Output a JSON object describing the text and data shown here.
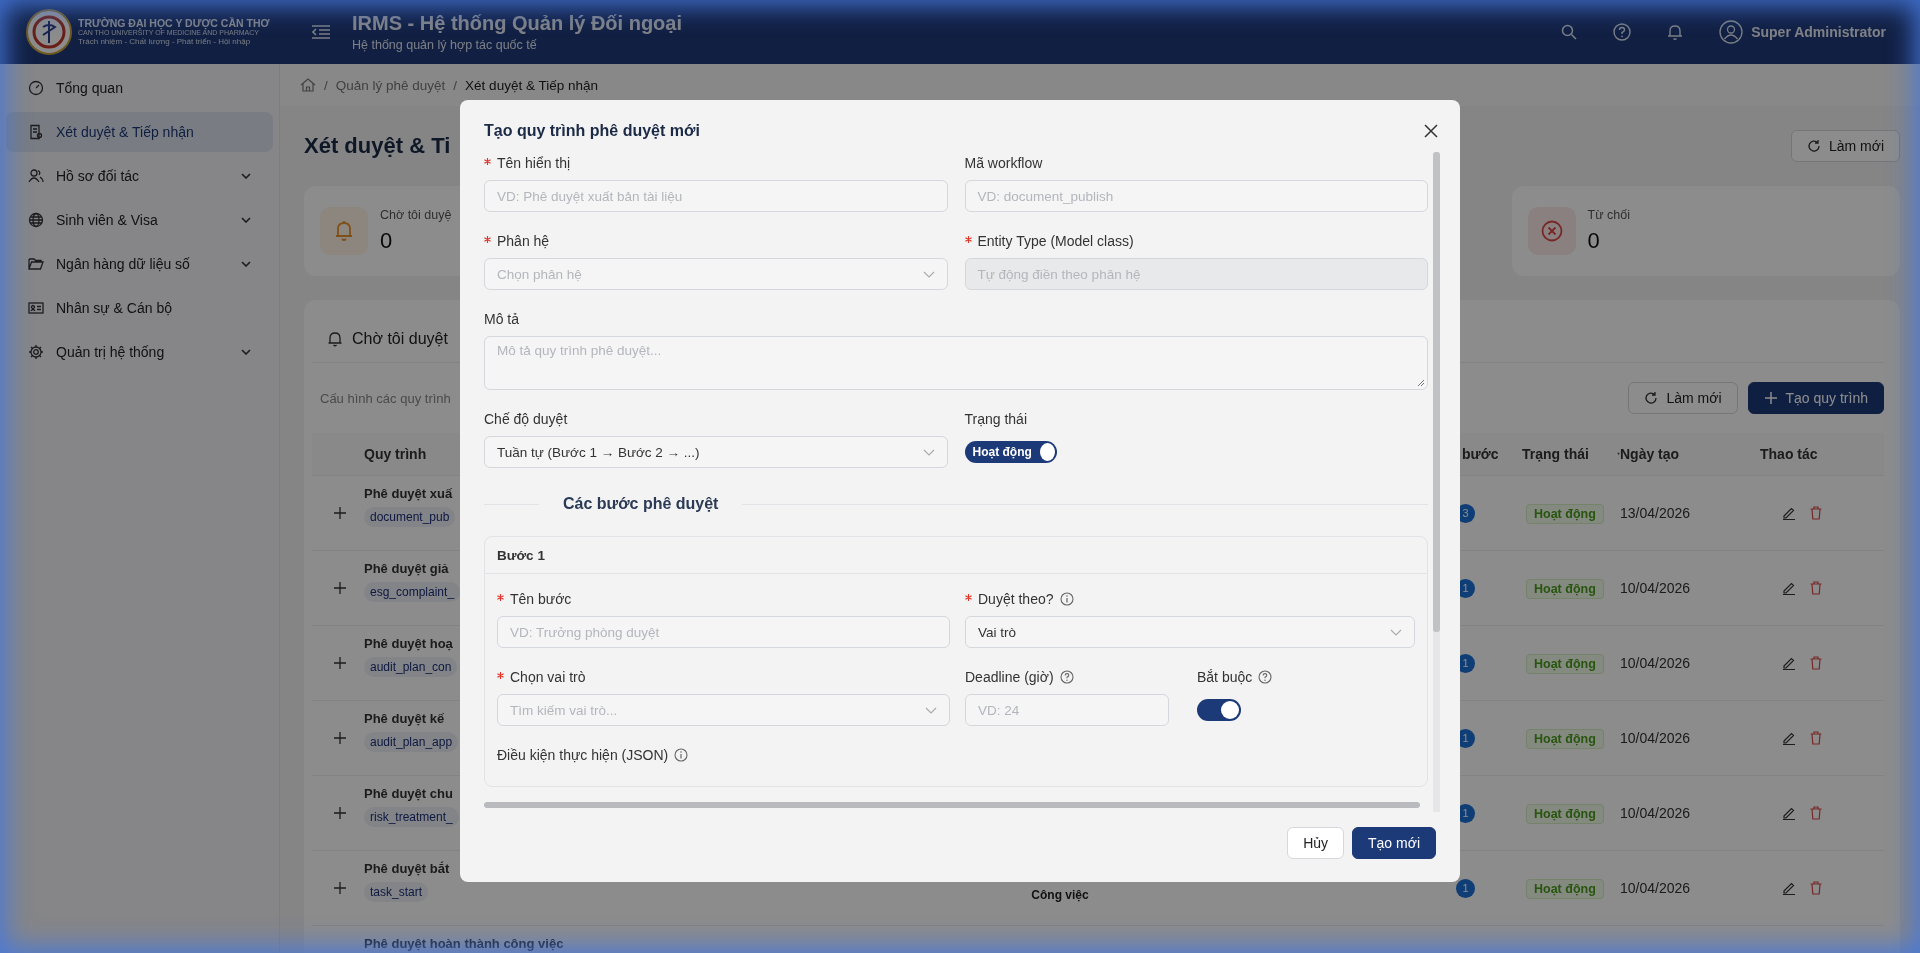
{
  "header": {
    "logo_lines": [
      "TRƯỜNG ĐẠI HỌC Y DƯỢC CẦN THƠ",
      "CAN THO UNIVERSITY OF MEDICINE AND PHARMACY",
      "Trách nhiệm - Chất lượng - Phát triển - Hội nhập"
    ],
    "title": "IRMS - Hệ thống Quản lý Đối ngoại",
    "subtitle": "Hệ thống quản lý hợp tác quốc tế",
    "user": "Super Administrator"
  },
  "sidebar": {
    "items": [
      {
        "label": "Tổng quan",
        "kind": "dashboard",
        "selected": false,
        "expandable": false
      },
      {
        "label": "Xét duyệt & Tiếp nhận",
        "kind": "document",
        "selected": true,
        "expandable": false
      },
      {
        "label": "Hồ sơ đối tác",
        "kind": "people",
        "selected": false,
        "expandable": true
      },
      {
        "label": "Sinh viên & Visa",
        "kind": "globe",
        "selected": false,
        "expandable": true
      },
      {
        "label": "Ngân hàng dữ liệu số",
        "kind": "folder",
        "selected": false,
        "expandable": true
      },
      {
        "label": "Nhân sự & Cán bộ",
        "kind": "idcard",
        "selected": false,
        "expandable": false
      },
      {
        "label": "Quản trị hệ thống",
        "kind": "gear",
        "selected": false,
        "expandable": true
      }
    ]
  },
  "breadcrumb": [
    {
      "separator": "/",
      "label": "Quản lý phê duyệt",
      "current": false
    },
    {
      "separator": "/",
      "label": "Xét duyệt & Tiếp nhận",
      "current": true
    }
  ],
  "page": {
    "title": "Xét duyệt & Ti",
    "refresh_button": "Làm mới"
  },
  "stats": [
    {
      "kind": "pending",
      "label": "Chờ tôi duyệ",
      "value": "0"
    },
    {
      "kind": "rejected",
      "label": "Từ chối",
      "value": "0"
    }
  ],
  "panel": {
    "tab": "Chờ tôi duyệt",
    "description": "Cấu hình các quy trình",
    "refresh_button": "Làm mới",
    "create_button": "Tạo quy trình"
  },
  "table": {
    "columns": {
      "name": "Quy trình",
      "steps": "bước",
      "status": "Trạng thái",
      "date": "Ngày tạo",
      "actions": "Thao tác"
    },
    "rows": [
      {
        "name": "Phê duyệt xuấ",
        "code": "document_pub",
        "steps": "3",
        "status": "Hoạt động",
        "date": "13/04/2026"
      },
      {
        "name": "Phê duyệt giả",
        "code": "esg_complaint_",
        "steps": "1",
        "status": "Hoạt động",
        "date": "10/04/2026"
      },
      {
        "name": "Phê duyệt hoạ",
        "code": "audit_plan_con",
        "steps": "1",
        "status": "Hoạt động",
        "date": "10/04/2026"
      },
      {
        "name": "Phê duyệt kế",
        "code": "audit_plan_app",
        "steps": "1",
        "status": "Hoạt động",
        "date": "10/04/2026"
      },
      {
        "name": "Phê duyệt chu",
        "code": "risk_treatment_",
        "steps": "1",
        "status": "Hoạt động",
        "date": "10/04/2026"
      },
      {
        "name": "Phê duyệt bắt",
        "code": "task_start",
        "column_3": "Công việc",
        "steps": "1",
        "status": "Hoạt động",
        "date": "10/04/2026"
      },
      {
        "name": "Phê duyệt hoàn thành công việc"
      }
    ]
  },
  "modal": {
    "title": "Tạo quy trình phê duyệt mới",
    "fields": [
      {
        "kind": "input",
        "label": "Tên hiển thị",
        "required": true,
        "disabled": false,
        "placeholder": "VD: Phê duyệt xuất bản tài liệu"
      },
      {
        "kind": "input",
        "label": "Mã workflow",
        "required": false,
        "disabled": false,
        "placeholder": "VD: document_publish"
      },
      {
        "kind": "select",
        "label": "Phân hệ",
        "required": true,
        "disabled": false,
        "placeholder": "Chọn phân hệ"
      },
      {
        "kind": "input",
        "label": "Entity Type (Model class)",
        "required": true,
        "disabled": true,
        "placeholder": "Tự động điền theo phân hệ"
      },
      {
        "kind": "textarea",
        "label": "Mô tả",
        "required": false,
        "disabled": false,
        "placeholder": "Mô tả quy trình phê duyệt..."
      },
      {
        "kind": "select",
        "label": "Chế độ duyệt",
        "required": false,
        "disabled": false,
        "value": "Tuần tự (Bước 1 → Bước 2 → ...)"
      },
      {
        "kind": "switch",
        "label": "Trạng thái",
        "required": false,
        "disabled": false,
        "on": true,
        "text": "Hoạt động"
      }
    ],
    "section_title": "Các bước phê duyệt",
    "step": {
      "title": "Bước 1",
      "fields": [
        {
          "kind": "input",
          "label": "Tên bước",
          "required": true,
          "info_icon": false,
          "help_icon": false,
          "placeholder": "VD: Trưởng phòng duyệt"
        },
        {
          "kind": "select",
          "label": "Duyệt theo?",
          "required": true,
          "info_icon": true,
          "help_icon": false,
          "value": "Vai trò"
        },
        {
          "kind": "select",
          "label": "Chọn vai trò",
          "required": true,
          "info_icon": false,
          "help_icon": false,
          "placeholder": "Tìm kiếm vai trò..."
        },
        {
          "kind": "input",
          "label": "Deadline (giờ)",
          "required": false,
          "info_icon": false,
          "help_icon": true,
          "placeholder": "VD: 24"
        },
        {
          "kind": "switch",
          "label": "Bắt buộc",
          "required": false,
          "info_icon": false,
          "help_icon": true,
          "on": true
        },
        {
          "kind": "heading",
          "label": "Điều kiện thực hiện (JSON)",
          "required": false,
          "info_icon": true,
          "help_icon": false
        }
      ]
    },
    "cancel_button": "Hủy",
    "submit_button": "Tạo mới"
  }
}
